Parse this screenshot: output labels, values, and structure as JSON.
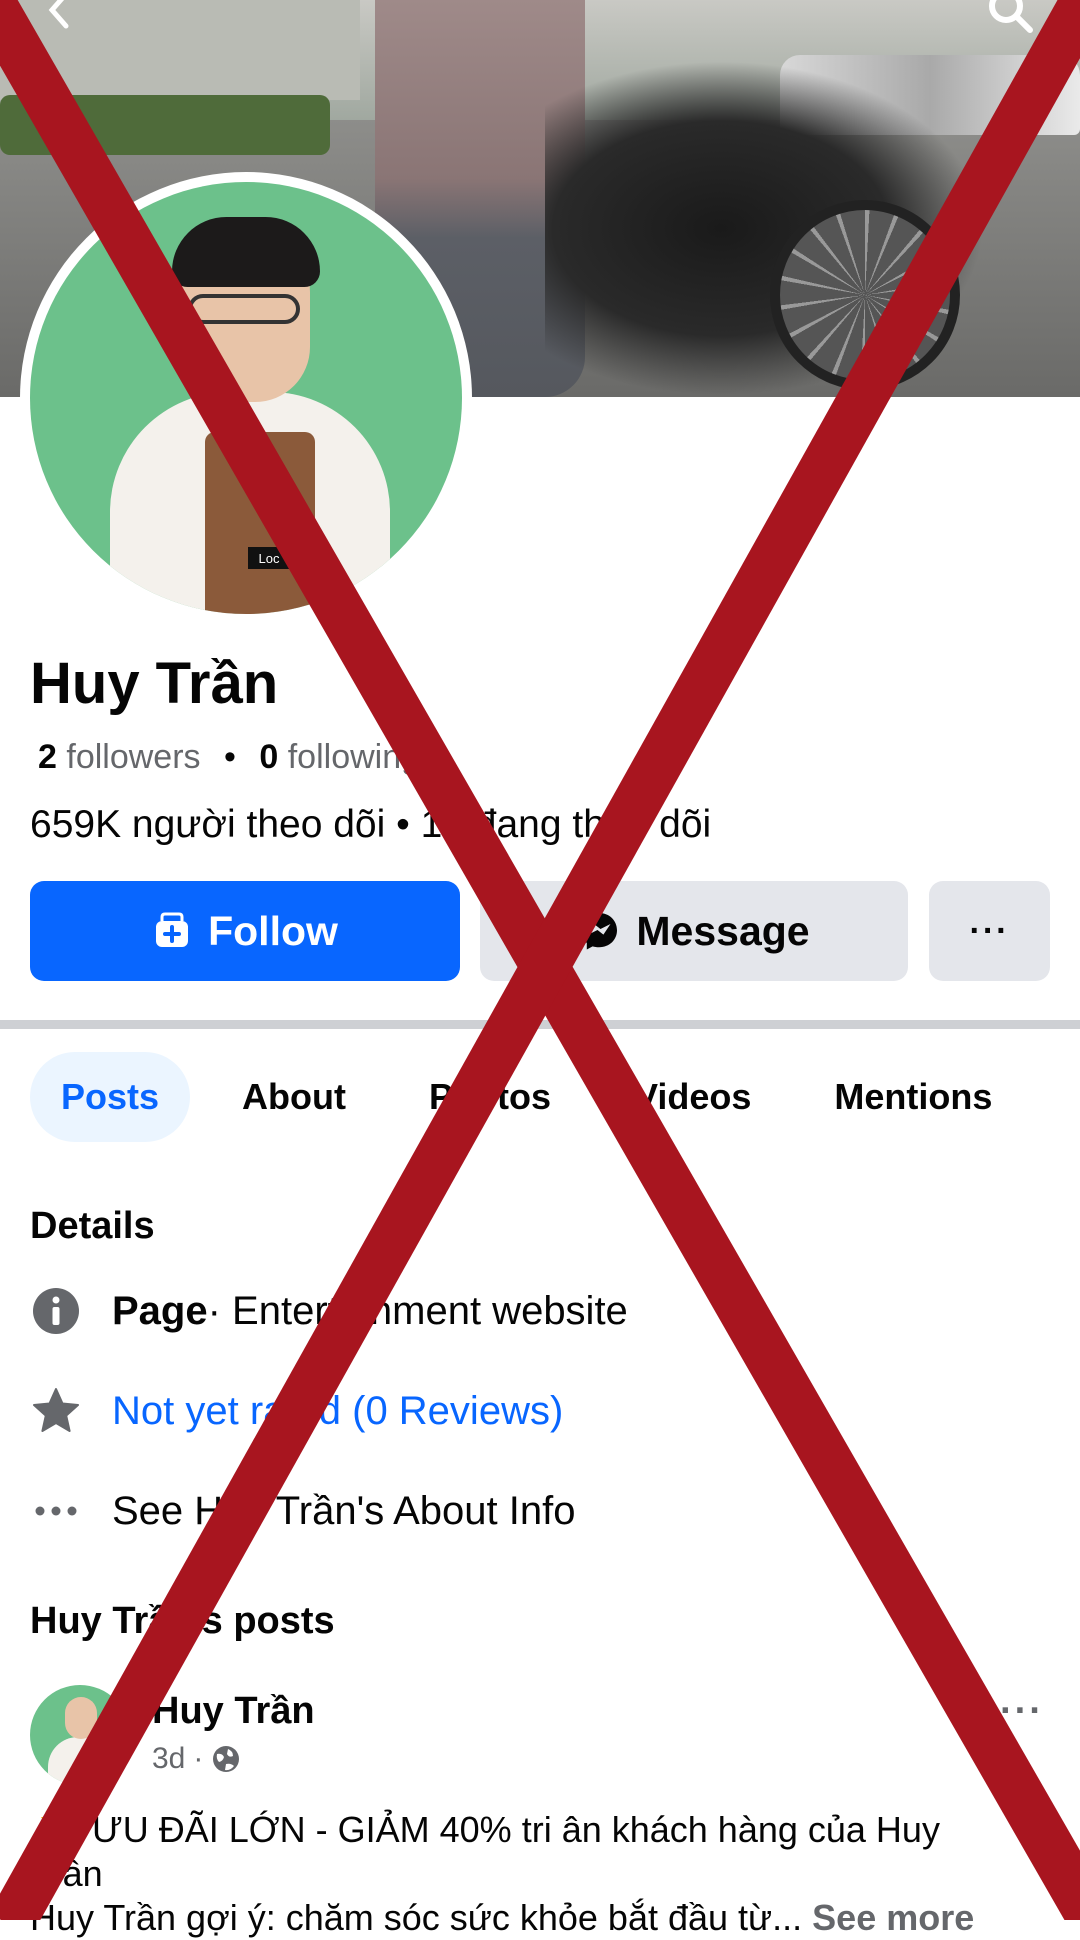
{
  "header": {
    "back_icon": "chevron-left-icon",
    "search_icon": "search-icon"
  },
  "profile": {
    "name": "Huy Trần",
    "followers_count": "2",
    "followers_label": "followers",
    "following_count": "0",
    "following_label": "following",
    "vn_stats": "659K người theo dõi • 16 đang theo dõi"
  },
  "actions": {
    "follow_label": "Follow",
    "message_label": "Message",
    "more_label": "···"
  },
  "tabs": [
    {
      "label": "Posts",
      "active": true
    },
    {
      "label": "About",
      "active": false
    },
    {
      "label": "Photos",
      "active": false
    },
    {
      "label": "Videos",
      "active": false
    },
    {
      "label": "Mentions",
      "active": false
    }
  ],
  "details": {
    "title": "Details",
    "page_label": "Page",
    "page_category": " · Entertainment website",
    "rating_text": "Not yet rated (0 Reviews)",
    "about_info": "See Huy Trần's About Info"
  },
  "posts": {
    "title": "Huy Trần's posts",
    "items": [
      {
        "author": "Huy Trần",
        "time": "3d",
        "meta_sep": "·",
        "text_line1": "ƯU ĐÃI LỚN - GIẢM 40% tri ân  khách hàng của Huy",
        "text_line2": "Trần",
        "text_line3": "Huy Trần gợi ý: chăm sóc sức khỏe bắt đầu từ...",
        "see_more": "See more"
      }
    ]
  },
  "colors": {
    "brand_blue": "#0866ff",
    "button_gray": "#e4e6eb",
    "cross_red": "#a8151f",
    "secondary_text": "#65676b"
  }
}
